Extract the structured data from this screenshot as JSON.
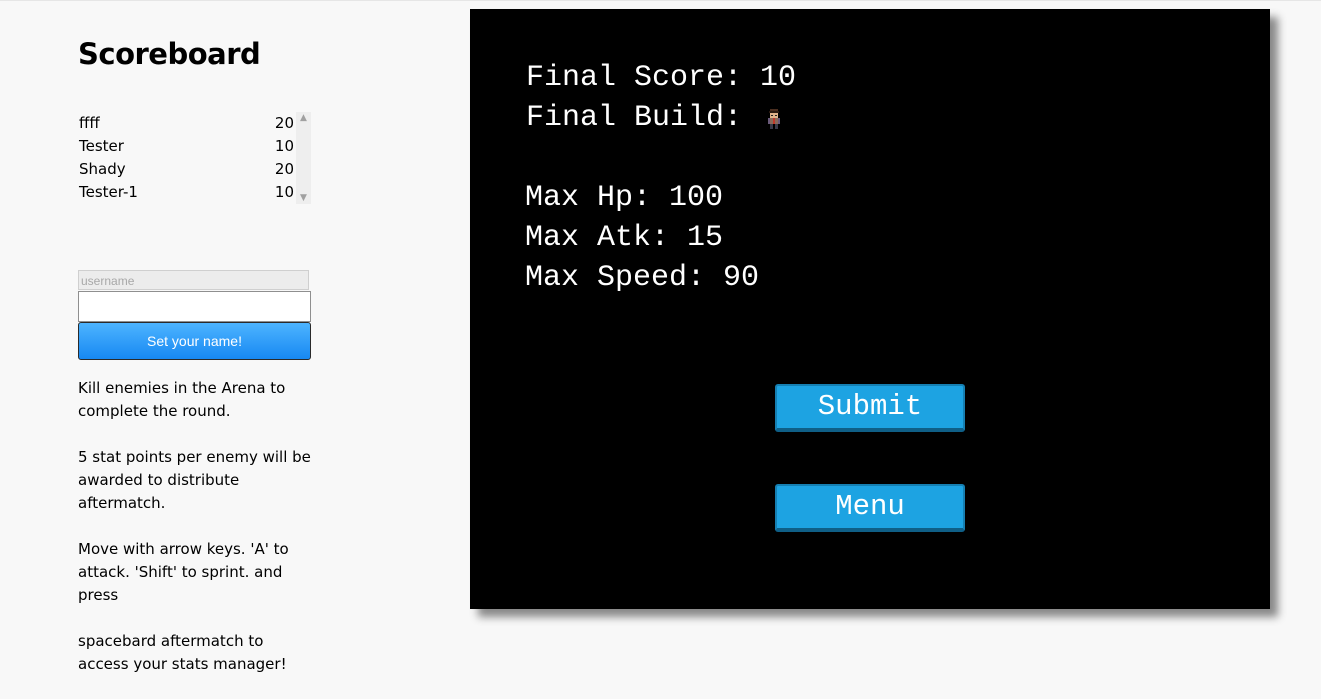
{
  "sidebar": {
    "title": "Scoreboard",
    "scores": [
      {
        "name": "ffff",
        "score": "20"
      },
      {
        "name": "Tester",
        "score": "10"
      },
      {
        "name": "Shady",
        "score": "20"
      },
      {
        "name": "Tester-1",
        "score": "10"
      }
    ],
    "username_placeholder": "username",
    "username_value": "",
    "set_name_label": "Set your name!",
    "instructions": [
      "Kill enemies in the Arena to complete the round.",
      "5 stat points per enemy will be awarded to distribute aftermatch.",
      "Move with arrow keys. 'A' to attack. 'Shift' to sprint. and press",
      "spacebard aftermatch to access your stats manager!"
    ]
  },
  "game": {
    "final_score": "Final Score: 10",
    "final_build": "Final Build:",
    "max_hp": "Max Hp: 100",
    "max_atk": "Max Atk: 15",
    "max_speed": "Max Speed: 90",
    "submit_label": "Submit",
    "menu_label": "Menu",
    "sprite_icon": "character-sprite-icon"
  },
  "colors": {
    "button_blue": "#1da3e2",
    "set_name_gradient_top": "#4db4ff",
    "set_name_gradient_bottom": "#1788f2",
    "game_background": "#000000"
  }
}
